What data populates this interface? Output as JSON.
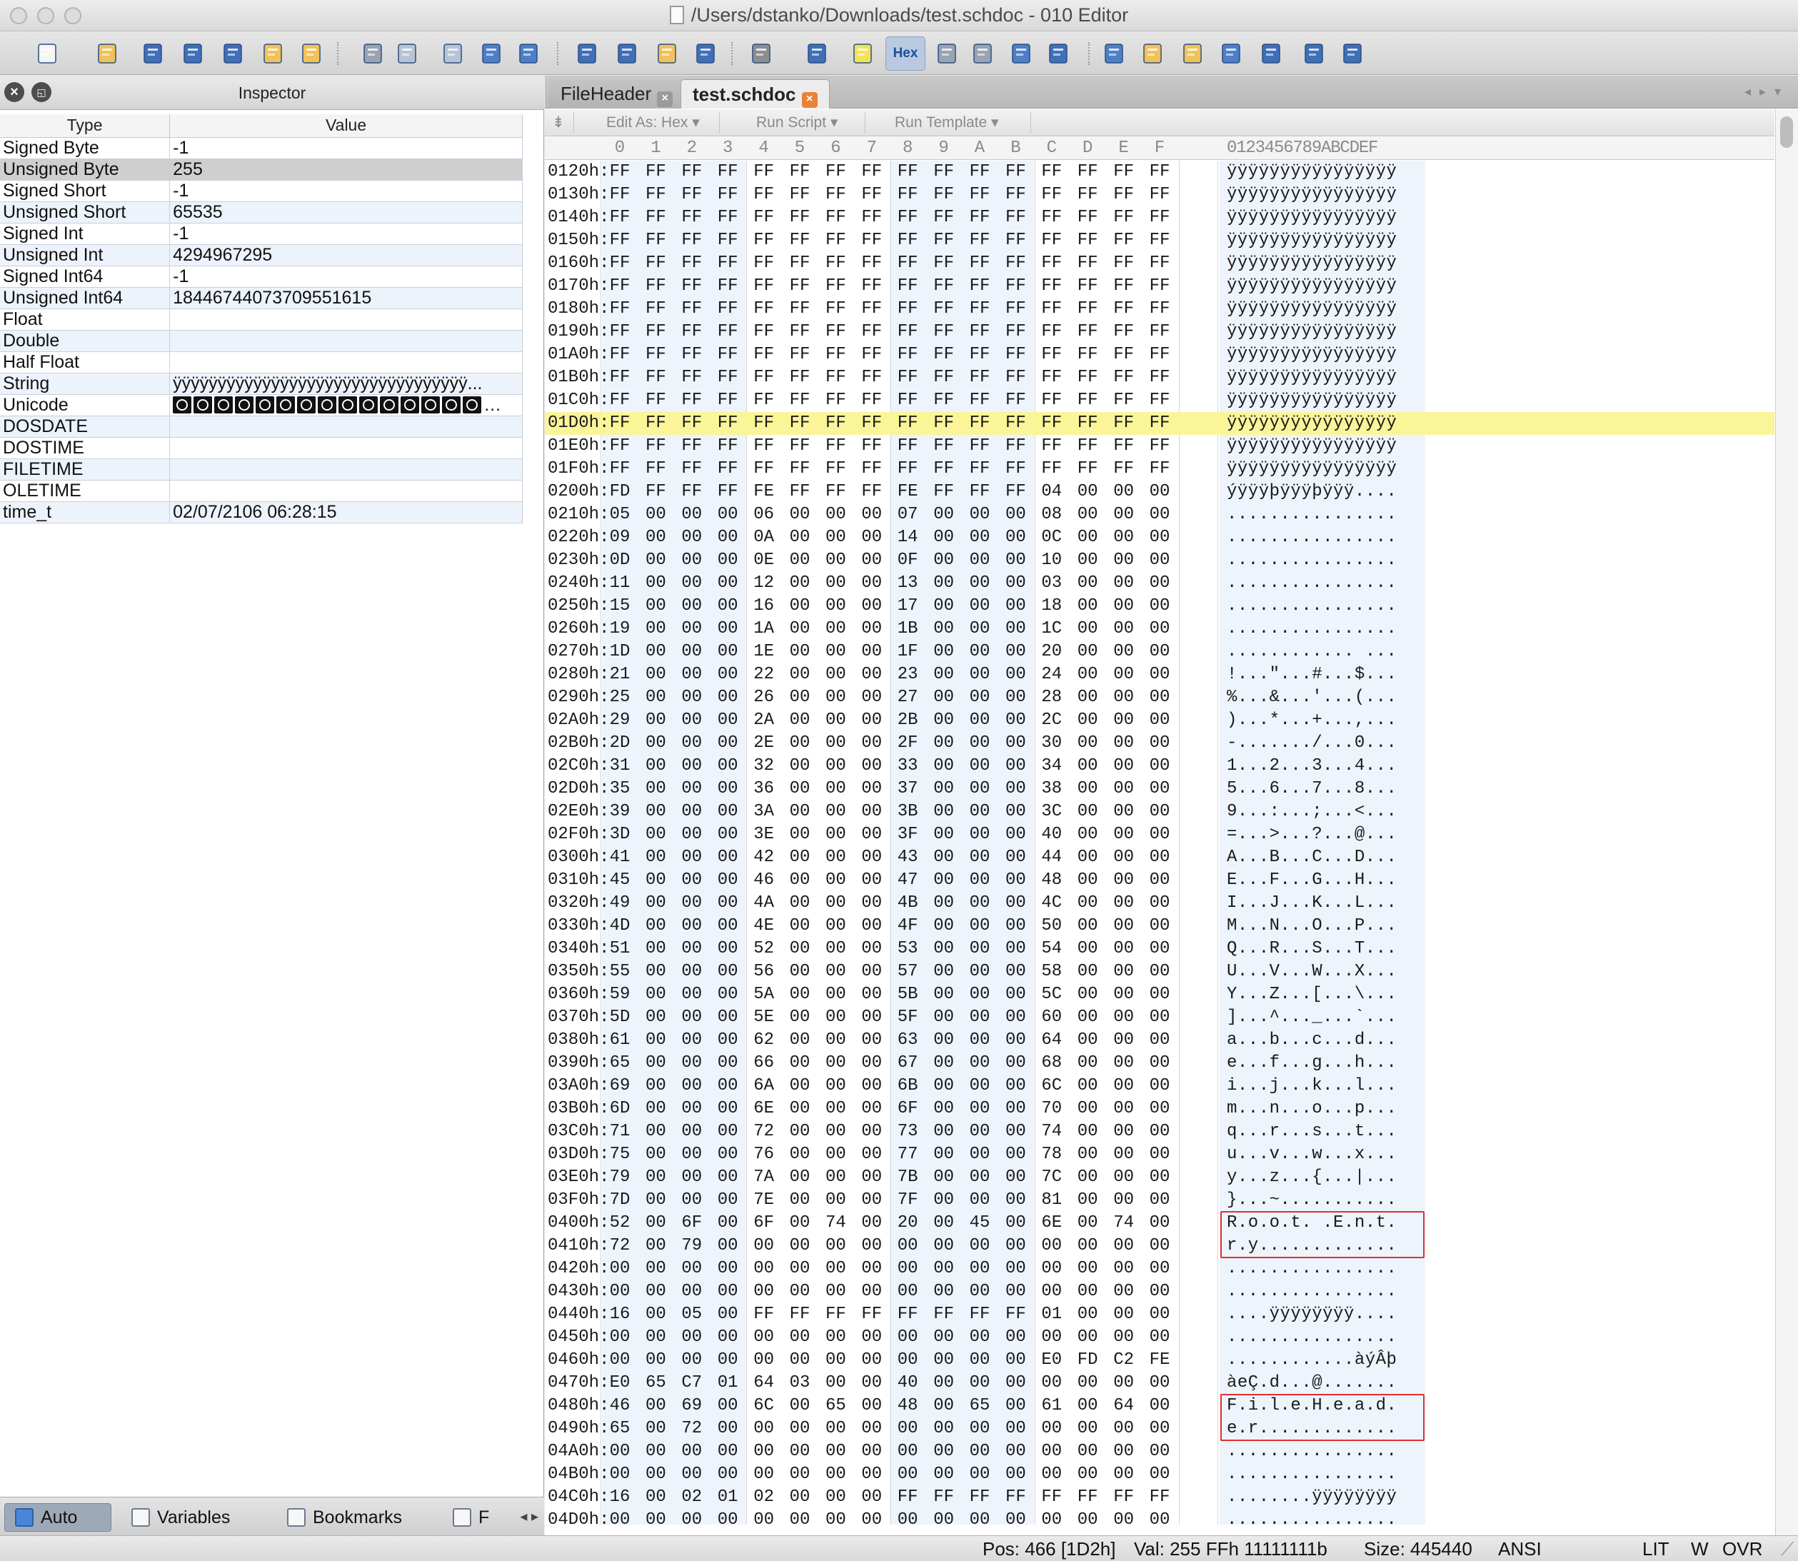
{
  "window": {
    "title": "/Users/dstanko/Downloads/test.schdoc - 010 Editor"
  },
  "toolbar": {
    "hex_label": "Hex",
    "icons": [
      "new-file-icon",
      "open-file-icon",
      "save-icon",
      "save-as-icon",
      "save-all-icon",
      "open-folder-icon",
      "close-file-icon",
      "cut-icon",
      "copy-icon",
      "paste-icon",
      "undo-icon",
      "redo-icon",
      "find-icon",
      "find-strings-icon",
      "replace-icon",
      "goto-icon",
      "print-icon",
      "font-icon",
      "highlight-icon",
      "hex-mode-icon",
      "columns-icon",
      "paragraph-icon",
      "split-icon",
      "binary-icon",
      "calculator-icon",
      "help-icon",
      "compare-icon",
      "checksum-icon",
      "histogram-icon",
      "template-icon",
      "base-converter-icon"
    ]
  },
  "inspector": {
    "title": "Inspector",
    "columns": {
      "type": "Type",
      "value": "Value"
    },
    "rows": [
      {
        "type": "Signed Byte",
        "value": "-1"
      },
      {
        "type": "Unsigned Byte",
        "value": "255",
        "selected": true
      },
      {
        "type": "Signed Short",
        "value": "-1"
      },
      {
        "type": "Unsigned Short",
        "value": "65535"
      },
      {
        "type": "Signed Int",
        "value": "-1"
      },
      {
        "type": "Unsigned Int",
        "value": "4294967295"
      },
      {
        "type": "Signed Int64",
        "value": "-1"
      },
      {
        "type": "Unsigned Int64",
        "value": "18446744073709551615"
      },
      {
        "type": "Float",
        "value": ""
      },
      {
        "type": "Double",
        "value": ""
      },
      {
        "type": "Half Float",
        "value": ""
      },
      {
        "type": "String",
        "value": "ÿÿÿÿÿÿÿÿÿÿÿÿÿÿÿÿÿÿÿÿÿÿÿÿÿÿÿÿÿÿÿÿÿ..."
      },
      {
        "type": "Unicode",
        "value": ""
      },
      {
        "type": "DOSDATE",
        "value": ""
      },
      {
        "type": "DOSTIME",
        "value": ""
      },
      {
        "type": "FILETIME",
        "value": ""
      },
      {
        "type": "OLETIME",
        "value": ""
      },
      {
        "type": "time_t",
        "value": "02/07/2106 06:28:15"
      }
    ],
    "tabs": [
      {
        "label": "Auto",
        "active": true
      },
      {
        "label": "Variables"
      },
      {
        "label": "Bookmarks"
      },
      {
        "label": "F"
      }
    ]
  },
  "editor": {
    "tabs": [
      {
        "label": "FileHeader",
        "active": false
      },
      {
        "label": "test.schdoc",
        "active": true
      }
    ],
    "sub_toolbar": {
      "edit_as": "Edit As: Hex",
      "run_script": "Run Script",
      "run_template": "Run Template"
    },
    "column_headers": [
      "0",
      "1",
      "2",
      "3",
      "4",
      "5",
      "6",
      "7",
      "8",
      "9",
      "A",
      "B",
      "C",
      "D",
      "E",
      "F"
    ],
    "ascii_header": "0123456789ABCDEF",
    "highlight_row": "01D0h:",
    "rows": [
      [
        "0120h:",
        "FF FF FF FF FF FF FF FF FF FF FF FF FF FF FF FF",
        "ÿÿÿÿÿÿÿÿÿÿÿÿÿÿÿÿ"
      ],
      [
        "0130h:",
        "FF FF FF FF FF FF FF FF FF FF FF FF FF FF FF FF",
        "ÿÿÿÿÿÿÿÿÿÿÿÿÿÿÿÿ"
      ],
      [
        "0140h:",
        "FF FF FF FF FF FF FF FF FF FF FF FF FF FF FF FF",
        "ÿÿÿÿÿÿÿÿÿÿÿÿÿÿÿÿ"
      ],
      [
        "0150h:",
        "FF FF FF FF FF FF FF FF FF FF FF FF FF FF FF FF",
        "ÿÿÿÿÿÿÿÿÿÿÿÿÿÿÿÿ"
      ],
      [
        "0160h:",
        "FF FF FF FF FF FF FF FF FF FF FF FF FF FF FF FF",
        "ÿÿÿÿÿÿÿÿÿÿÿÿÿÿÿÿ"
      ],
      [
        "0170h:",
        "FF FF FF FF FF FF FF FF FF FF FF FF FF FF FF FF",
        "ÿÿÿÿÿÿÿÿÿÿÿÿÿÿÿÿ"
      ],
      [
        "0180h:",
        "FF FF FF FF FF FF FF FF FF FF FF FF FF FF FF FF",
        "ÿÿÿÿÿÿÿÿÿÿÿÿÿÿÿÿ"
      ],
      [
        "0190h:",
        "FF FF FF FF FF FF FF FF FF FF FF FF FF FF FF FF",
        "ÿÿÿÿÿÿÿÿÿÿÿÿÿÿÿÿ"
      ],
      [
        "01A0h:",
        "FF FF FF FF FF FF FF FF FF FF FF FF FF FF FF FF",
        "ÿÿÿÿÿÿÿÿÿÿÿÿÿÿÿÿ"
      ],
      [
        "01B0h:",
        "FF FF FF FF FF FF FF FF FF FF FF FF FF FF FF FF",
        "ÿÿÿÿÿÿÿÿÿÿÿÿÿÿÿÿ"
      ],
      [
        "01C0h:",
        "FF FF FF FF FF FF FF FF FF FF FF FF FF FF FF FF",
        "ÿÿÿÿÿÿÿÿÿÿÿÿÿÿÿÿ"
      ],
      [
        "01D0h:",
        "FF FF FF FF FF FF FF FF FF FF FF FF FF FF FF FF",
        "ÿÿÿÿÿÿÿÿÿÿÿÿÿÿÿÿ"
      ],
      [
        "01E0h:",
        "FF FF FF FF FF FF FF FF FF FF FF FF FF FF FF FF",
        "ÿÿÿÿÿÿÿÿÿÿÿÿÿÿÿÿ"
      ],
      [
        "01F0h:",
        "FF FF FF FF FF FF FF FF FF FF FF FF FF FF FF FF",
        "ÿÿÿÿÿÿÿÿÿÿÿÿÿÿÿÿ"
      ],
      [
        "0200h:",
        "FD FF FF FF FE FF FF FF FE FF FF FF 04 00 00 00",
        "ýÿÿÿþÿÿÿþÿÿÿ...."
      ],
      [
        "0210h:",
        "05 00 00 00 06 00 00 00 07 00 00 00 08 00 00 00",
        "................"
      ],
      [
        "0220h:",
        "09 00 00 00 0A 00 00 00 14 00 00 00 0C 00 00 00",
        "................"
      ],
      [
        "0230h:",
        "0D 00 00 00 0E 00 00 00 0F 00 00 00 10 00 00 00",
        "................"
      ],
      [
        "0240h:",
        "11 00 00 00 12 00 00 00 13 00 00 00 03 00 00 00",
        "................"
      ],
      [
        "0250h:",
        "15 00 00 00 16 00 00 00 17 00 00 00 18 00 00 00",
        "................"
      ],
      [
        "0260h:",
        "19 00 00 00 1A 00 00 00 1B 00 00 00 1C 00 00 00",
        "................"
      ],
      [
        "0270h:",
        "1D 00 00 00 1E 00 00 00 1F 00 00 00 20 00 00 00",
        "............ ..."
      ],
      [
        "0280h:",
        "21 00 00 00 22 00 00 00 23 00 00 00 24 00 00 00",
        "!...\"...#...$..."
      ],
      [
        "0290h:",
        "25 00 00 00 26 00 00 00 27 00 00 00 28 00 00 00",
        "%...&...'...(..."
      ],
      [
        "02A0h:",
        "29 00 00 00 2A 00 00 00 2B 00 00 00 2C 00 00 00",
        ")...*...+...,..."
      ],
      [
        "02B0h:",
        "2D 00 00 00 2E 00 00 00 2F 00 00 00 30 00 00 00",
        "-......./...0..."
      ],
      [
        "02C0h:",
        "31 00 00 00 32 00 00 00 33 00 00 00 34 00 00 00",
        "1...2...3...4..."
      ],
      [
        "02D0h:",
        "35 00 00 00 36 00 00 00 37 00 00 00 38 00 00 00",
        "5...6...7...8..."
      ],
      [
        "02E0h:",
        "39 00 00 00 3A 00 00 00 3B 00 00 00 3C 00 00 00",
        "9...:...;...<..."
      ],
      [
        "02F0h:",
        "3D 00 00 00 3E 00 00 00 3F 00 00 00 40 00 00 00",
        "=...>...?...@..."
      ],
      [
        "0300h:",
        "41 00 00 00 42 00 00 00 43 00 00 00 44 00 00 00",
        "A...B...C...D..."
      ],
      [
        "0310h:",
        "45 00 00 00 46 00 00 00 47 00 00 00 48 00 00 00",
        "E...F...G...H..."
      ],
      [
        "0320h:",
        "49 00 00 00 4A 00 00 00 4B 00 00 00 4C 00 00 00",
        "I...J...K...L..."
      ],
      [
        "0330h:",
        "4D 00 00 00 4E 00 00 00 4F 00 00 00 50 00 00 00",
        "M...N...O...P..."
      ],
      [
        "0340h:",
        "51 00 00 00 52 00 00 00 53 00 00 00 54 00 00 00",
        "Q...R...S...T..."
      ],
      [
        "0350h:",
        "55 00 00 00 56 00 00 00 57 00 00 00 58 00 00 00",
        "U...V...W...X..."
      ],
      [
        "0360h:",
        "59 00 00 00 5A 00 00 00 5B 00 00 00 5C 00 00 00",
        "Y...Z...[...\\..."
      ],
      [
        "0370h:",
        "5D 00 00 00 5E 00 00 00 5F 00 00 00 60 00 00 00",
        "]...^..._...`..."
      ],
      [
        "0380h:",
        "61 00 00 00 62 00 00 00 63 00 00 00 64 00 00 00",
        "a...b...c...d..."
      ],
      [
        "0390h:",
        "65 00 00 00 66 00 00 00 67 00 00 00 68 00 00 00",
        "e...f...g...h..."
      ],
      [
        "03A0h:",
        "69 00 00 00 6A 00 00 00 6B 00 00 00 6C 00 00 00",
        "i...j...k...l..."
      ],
      [
        "03B0h:",
        "6D 00 00 00 6E 00 00 00 6F 00 00 00 70 00 00 00",
        "m...n...o...p..."
      ],
      [
        "03C0h:",
        "71 00 00 00 72 00 00 00 73 00 00 00 74 00 00 00",
        "q...r...s...t..."
      ],
      [
        "03D0h:",
        "75 00 00 00 76 00 00 00 77 00 00 00 78 00 00 00",
        "u...v...w...x..."
      ],
      [
        "03E0h:",
        "79 00 00 00 7A 00 00 00 7B 00 00 00 7C 00 00 00",
        "y...z...{...|..."
      ],
      [
        "03F0h:",
        "7D 00 00 00 7E 00 00 00 7F 00 00 00 81 00 00 00",
        "}...~..........."
      ],
      [
        "0400h:",
        "52 00 6F 00 6F 00 74 00 20 00 45 00 6E 00 74 00",
        "R.o.o.t. .E.n.t."
      ],
      [
        "0410h:",
        "72 00 79 00 00 00 00 00 00 00 00 00 00 00 00 00",
        "r.y............."
      ],
      [
        "0420h:",
        "00 00 00 00 00 00 00 00 00 00 00 00 00 00 00 00",
        "................"
      ],
      [
        "0430h:",
        "00 00 00 00 00 00 00 00 00 00 00 00 00 00 00 00",
        "................"
      ],
      [
        "0440h:",
        "16 00 05 00 FF FF FF FF FF FF FF FF 01 00 00 00",
        "....ÿÿÿÿÿÿÿÿ...."
      ],
      [
        "0450h:",
        "00 00 00 00 00 00 00 00 00 00 00 00 00 00 00 00",
        "................"
      ],
      [
        "0460h:",
        "00 00 00 00 00 00 00 00 00 00 00 00 E0 FD C2 FE",
        "............àýÂþ"
      ],
      [
        "0470h:",
        "E0 65 C7 01 64 03 00 00 40 00 00 00 00 00 00 00",
        "àeÇ.d...@......."
      ],
      [
        "0480h:",
        "46 00 69 00 6C 00 65 00 48 00 65 00 61 00 64 00",
        "F.i.l.e.H.e.a.d."
      ],
      [
        "0490h:",
        "65 00 72 00 00 00 00 00 00 00 00 00 00 00 00 00",
        "e.r............."
      ],
      [
        "04A0h:",
        "00 00 00 00 00 00 00 00 00 00 00 00 00 00 00 00",
        "................"
      ],
      [
        "04B0h:",
        "00 00 00 00 00 00 00 00 00 00 00 00 00 00 00 00",
        "................"
      ],
      [
        "04C0h:",
        "16 00 02 01 02 00 00 00 FF FF FF FF FF FF FF FF",
        "........ÿÿÿÿÿÿÿÿ"
      ],
      [
        "04D0h:",
        "00 00 00 00 00 00 00 00 00 00 00 00 00 00 00 00",
        "................"
      ]
    ]
  },
  "status": {
    "pos": "Pos: 466 [1D2h]",
    "val": "Val: 255 FFh 11111111b",
    "size": "Size: 445440",
    "encoding": "ANSI",
    "lit": "LIT",
    "w": "W",
    "ovr": "OVR"
  },
  "colors": {
    "highlight": "#fbf599",
    "annotation_box": "#e0302f",
    "tab_close_active": "#e8823a",
    "zebra": "#edf3fb"
  }
}
